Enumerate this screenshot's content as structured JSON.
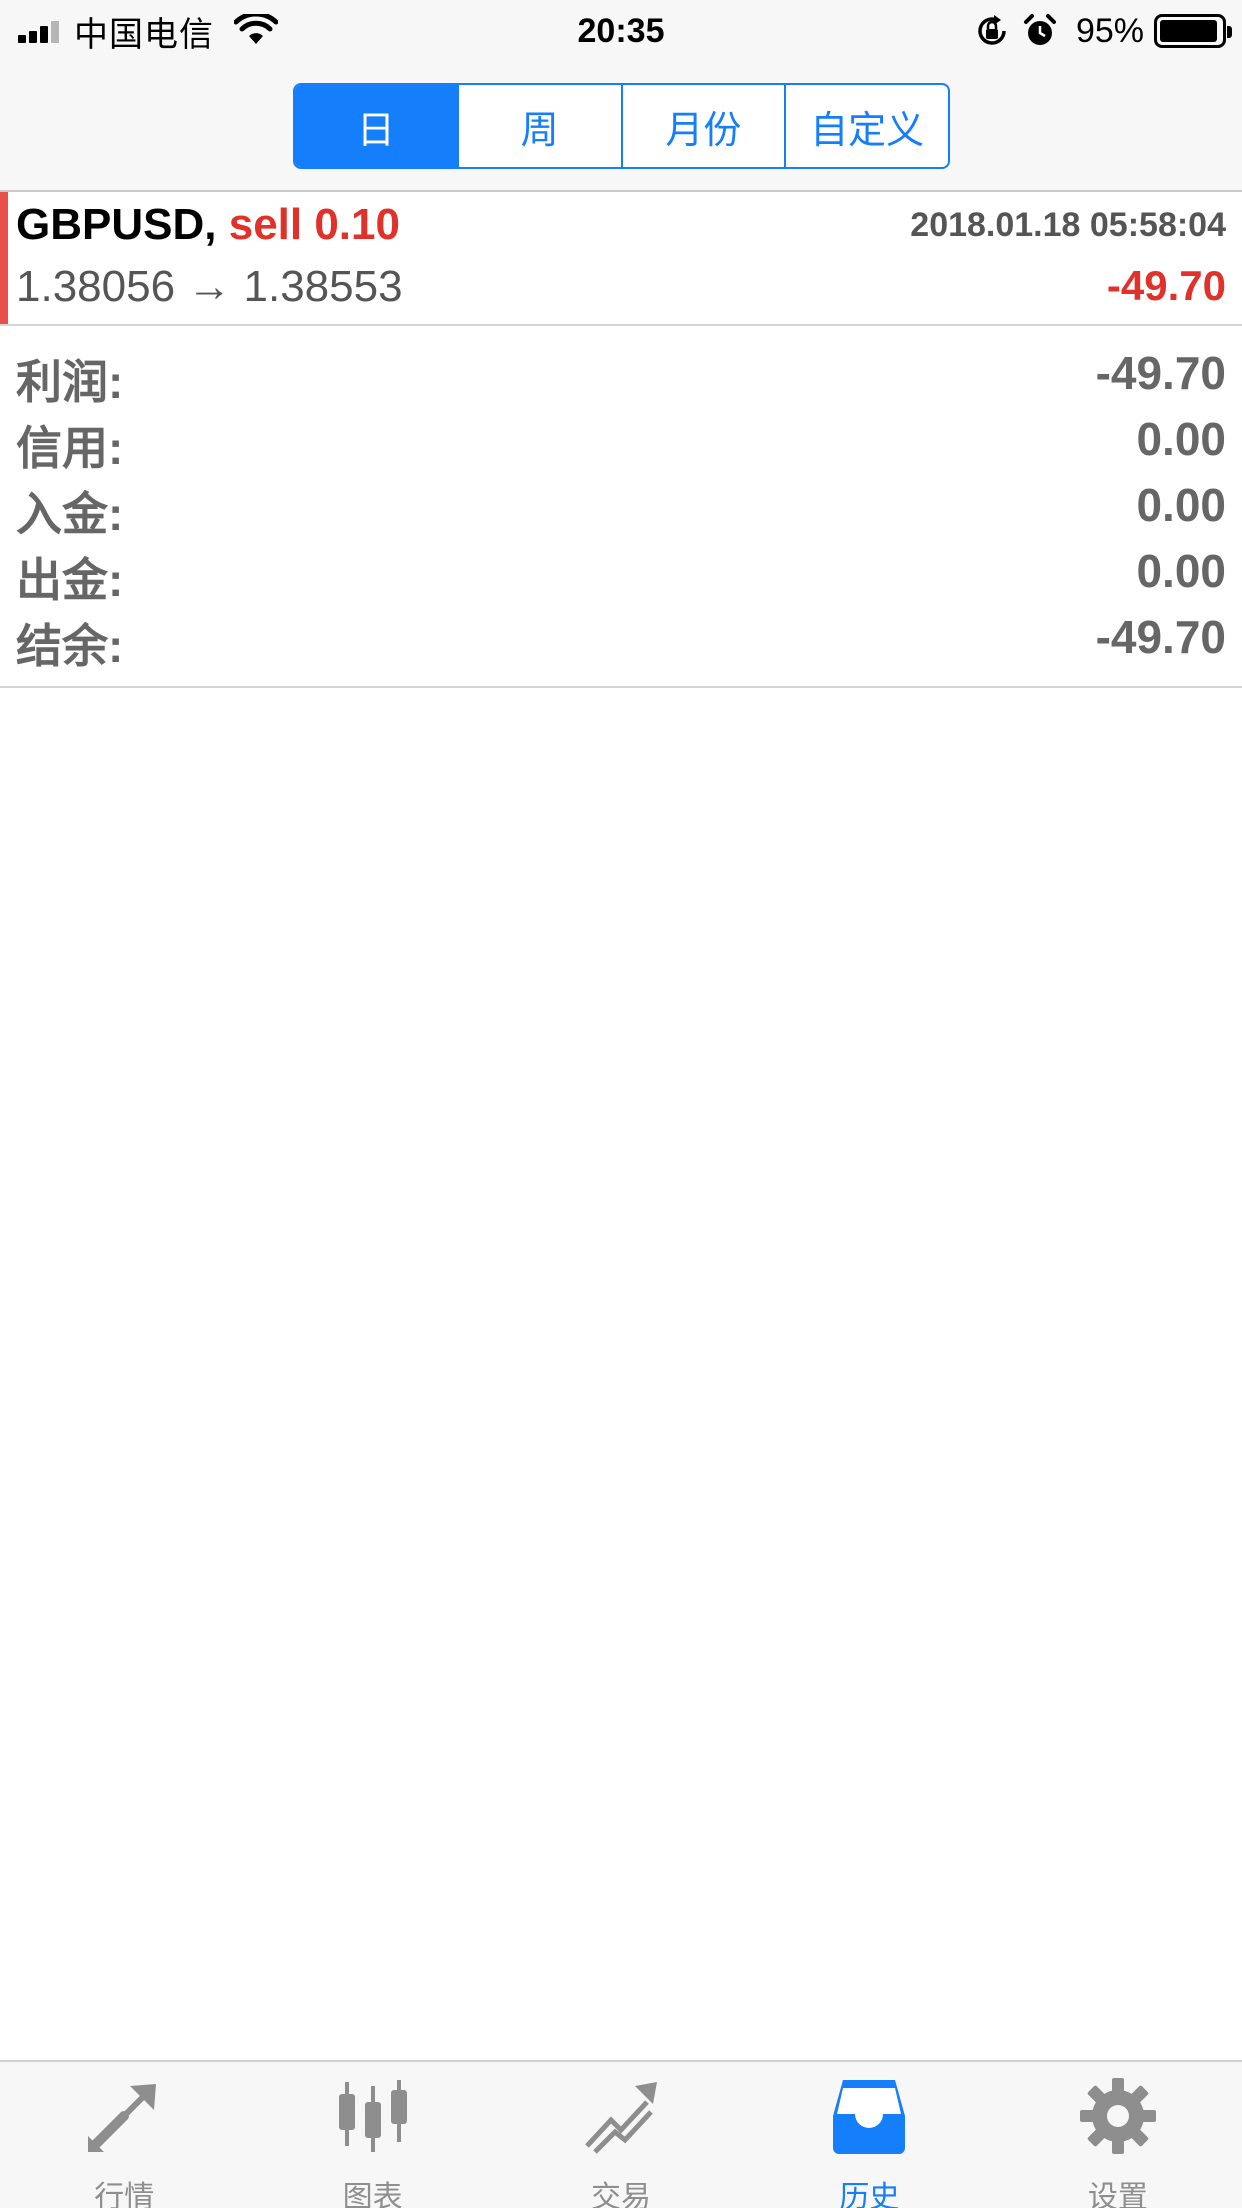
{
  "status_bar": {
    "carrier": "中国电信",
    "time": "20:35",
    "battery_percent": "95%",
    "battery_level": 0.95
  },
  "segments": {
    "items": [
      "日",
      "周",
      "月份",
      "自定义"
    ],
    "active_index": 0
  },
  "deal": {
    "symbol": "GBPUSD,",
    "side": "sell 0.10",
    "datetime": "2018.01.18 05:58:04",
    "prices": "1.38056 → 1.38553",
    "profit": "-49.70"
  },
  "summary": [
    {
      "label": "利润:",
      "value": "-49.70"
    },
    {
      "label": "信用:",
      "value": "0.00"
    },
    {
      "label": "入金:",
      "value": "0.00"
    },
    {
      "label": "出金:",
      "value": "0.00"
    },
    {
      "label": "结余:",
      "value": "-49.70"
    }
  ],
  "tabbar": {
    "items": [
      {
        "label": "行情",
        "icon": "quotes-arrows-icon"
      },
      {
        "label": "图表",
        "icon": "candlestick-chart-icon"
      },
      {
        "label": "交易",
        "icon": "trade-trend-icon"
      },
      {
        "label": "历史",
        "icon": "history-inbox-icon"
      },
      {
        "label": "设置",
        "icon": "gear-icon"
      }
    ],
    "active_index": 3
  },
  "colors": {
    "accent": "#157efb",
    "loss": "#e0322b",
    "muted": "#8e8e8e"
  }
}
